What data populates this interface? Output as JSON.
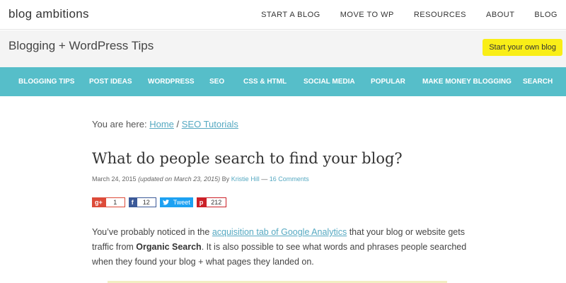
{
  "site": {
    "logo": "blog ambitions",
    "tagline": "Blogging + WordPress Tips",
    "cta_label": "Start your own blog"
  },
  "top_nav": {
    "items": [
      {
        "label": "START A BLOG"
      },
      {
        "label": "MOVE TO WP"
      },
      {
        "label": "RESOURCES"
      },
      {
        "label": "ABOUT"
      },
      {
        "label": "BLOG"
      }
    ]
  },
  "main_nav": {
    "items": [
      {
        "label": "BLOGGING TIPS"
      },
      {
        "label": "POST IDEAS"
      },
      {
        "label": "WORDPRESS"
      },
      {
        "label": "SEO"
      },
      {
        "label": "CSS & HTML"
      },
      {
        "label": "SOCIAL MEDIA"
      },
      {
        "label": "POPULAR"
      },
      {
        "label": "MAKE MONEY BLOGGING"
      },
      {
        "label": "SEARCH"
      }
    ]
  },
  "breadcrumb": {
    "prefix": "You are here: ",
    "items": [
      {
        "label": "Home"
      },
      {
        "label": "SEO Tutorials"
      }
    ],
    "separator": " / "
  },
  "post": {
    "title": "What do people search to find your blog?",
    "date": "March 24, 2015",
    "updated": "(updated on March 23, 2015)",
    "by": "By",
    "author": "Kristie Hill",
    "dash": "—",
    "comments": "16 Comments",
    "paragraph": {
      "part1": "You’ve probably noticed in the ",
      "link": "acquisition tab of Google Analytics",
      "part2": " that your blog or website gets traffic from ",
      "strong": "Organic Search",
      "part3": ". It is also possible to see what words and phrases people searched when they found your blog + what pages they landed on."
    }
  },
  "share": {
    "googleplus": {
      "icon": "g+",
      "count": "1"
    },
    "facebook": {
      "icon": "f",
      "count": "12"
    },
    "twitter": {
      "icon": "twitter-bird",
      "label": "Tweet"
    },
    "pinterest": {
      "icon": "p",
      "count": "212"
    }
  },
  "colors": {
    "nav_bg": "#56bec9",
    "cta_bg": "#f9ee17",
    "link": "#56a9c2",
    "header_bg": "#f4f4f4"
  }
}
